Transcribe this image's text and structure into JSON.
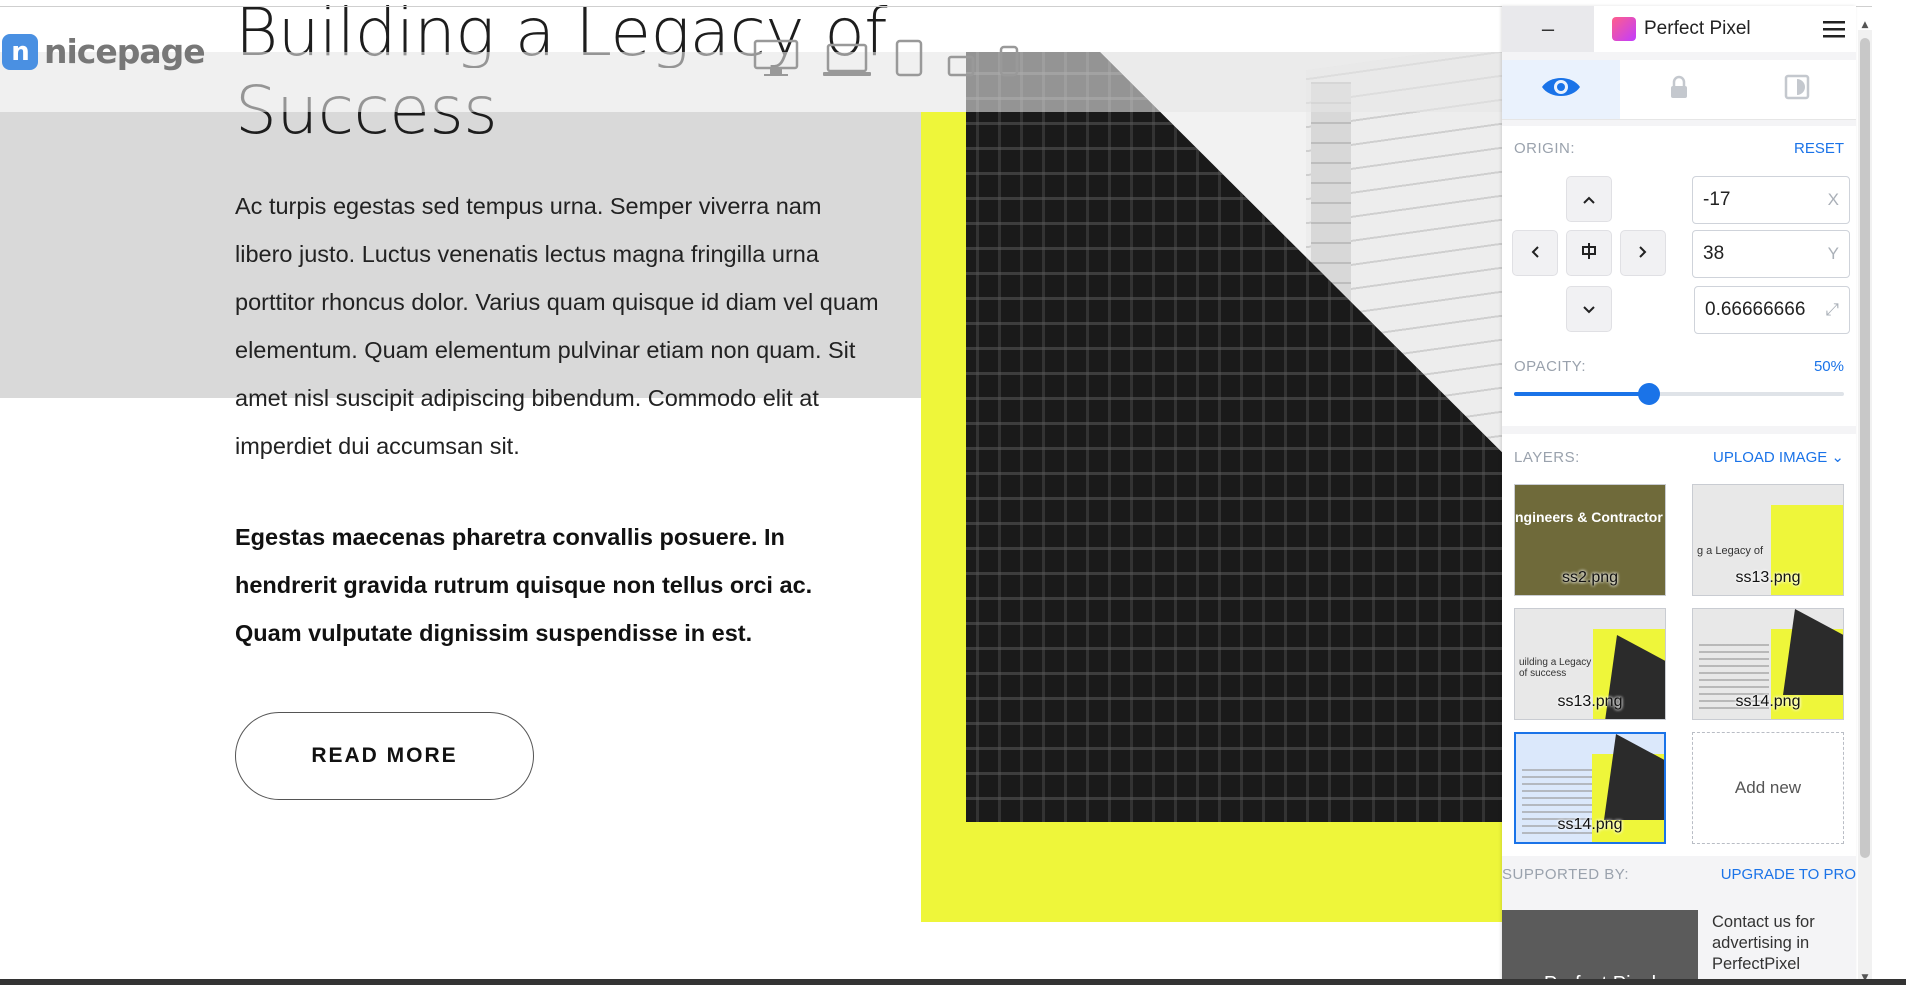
{
  "page": {
    "heading_line1": "Building a Legacy of",
    "heading_line2": "Success",
    "body": "Ac turpis egestas sed tempus urna. Semper viverra nam libero justo. Luctus venenatis lectus magna fringilla urna porttitor rhoncus dolor. Varius quam quisque id diam vel quam elementum. Quam elementum pulvinar etiam non quam. Sit amet nisl suscipit adipiscing bibendum. Commodo elit at imperdiet dui accumsan sit.",
    "bold": "Egestas maecenas pharetra convallis posuere. In hendrerit gravida rutrum quisque non tellus orci ac. Quam vulputate dignissim suspendisse in est.",
    "read_more": "READ MORE",
    "accent_color": "#eef63a"
  },
  "toolbar": {
    "logo_text": "nicepage",
    "devices": [
      "desktop-icon",
      "laptop-icon",
      "tablet-icon",
      "tablet-landscape-icon",
      "phone-icon"
    ]
  },
  "panel": {
    "minimize": "–",
    "title": "Perfect Pixel",
    "tabs": [
      "eye-icon",
      "lock-icon",
      "invert-icon"
    ],
    "origin_label": "ORIGIN:",
    "reset": "RESET",
    "x_value": "-17",
    "x_unit": "X",
    "y_value": "38",
    "y_unit": "Y",
    "scale_value": "0.66666666",
    "opacity_label": "OPACITY:",
    "opacity_value": "50%",
    "opacity_fraction": 0.5,
    "layers_label": "LAYERS:",
    "upload": "UPLOAD IMAGE",
    "layers": [
      {
        "name": "ss2.png",
        "caption": "ngineers & Contractor"
      },
      {
        "name": "ss13.png",
        "caption": "g a Legacy of"
      },
      {
        "name": "ss13.png",
        "caption": "uilding a Legacy of success"
      },
      {
        "name": "ss14.png",
        "caption": ""
      },
      {
        "name": "ss14.png",
        "caption": ""
      }
    ],
    "add_new": "Add new",
    "supported_by": "SUPPORTED BY:",
    "upgrade": "UPGRADE TO PRO",
    "ad_image_text": "Perfect Pixel",
    "ad_text": "Contact us for advertising in PerfectPixel"
  }
}
